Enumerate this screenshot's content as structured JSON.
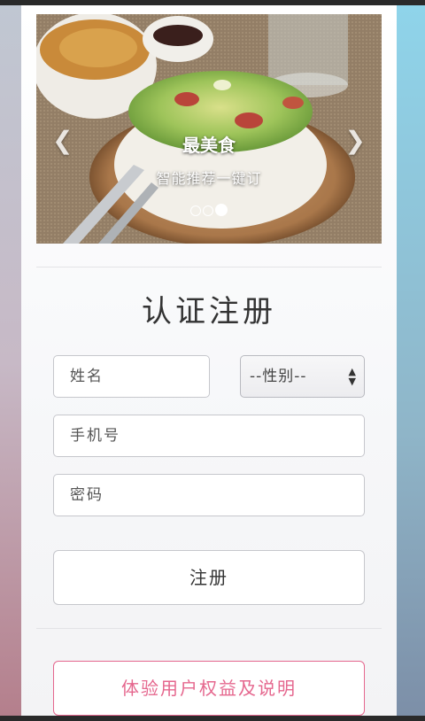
{
  "carousel": {
    "title": "最美食",
    "subtitle": "智能推荐一键订",
    "prev_icon": "chevron-left-icon",
    "next_icon": "chevron-right-icon",
    "slide_count": 3,
    "active_slide": 3
  },
  "form": {
    "title": "认证注册",
    "name_placeholder": "姓名",
    "gender_select": "--性别--",
    "phone_placeholder": "手机号",
    "password_placeholder": "密码",
    "submit_label": "注册"
  },
  "footer": {
    "benefits_label": "体验用户权益及说明"
  },
  "colors": {
    "accent": "#e5678e",
    "text": "#333333",
    "border": "#c6c7cc"
  }
}
